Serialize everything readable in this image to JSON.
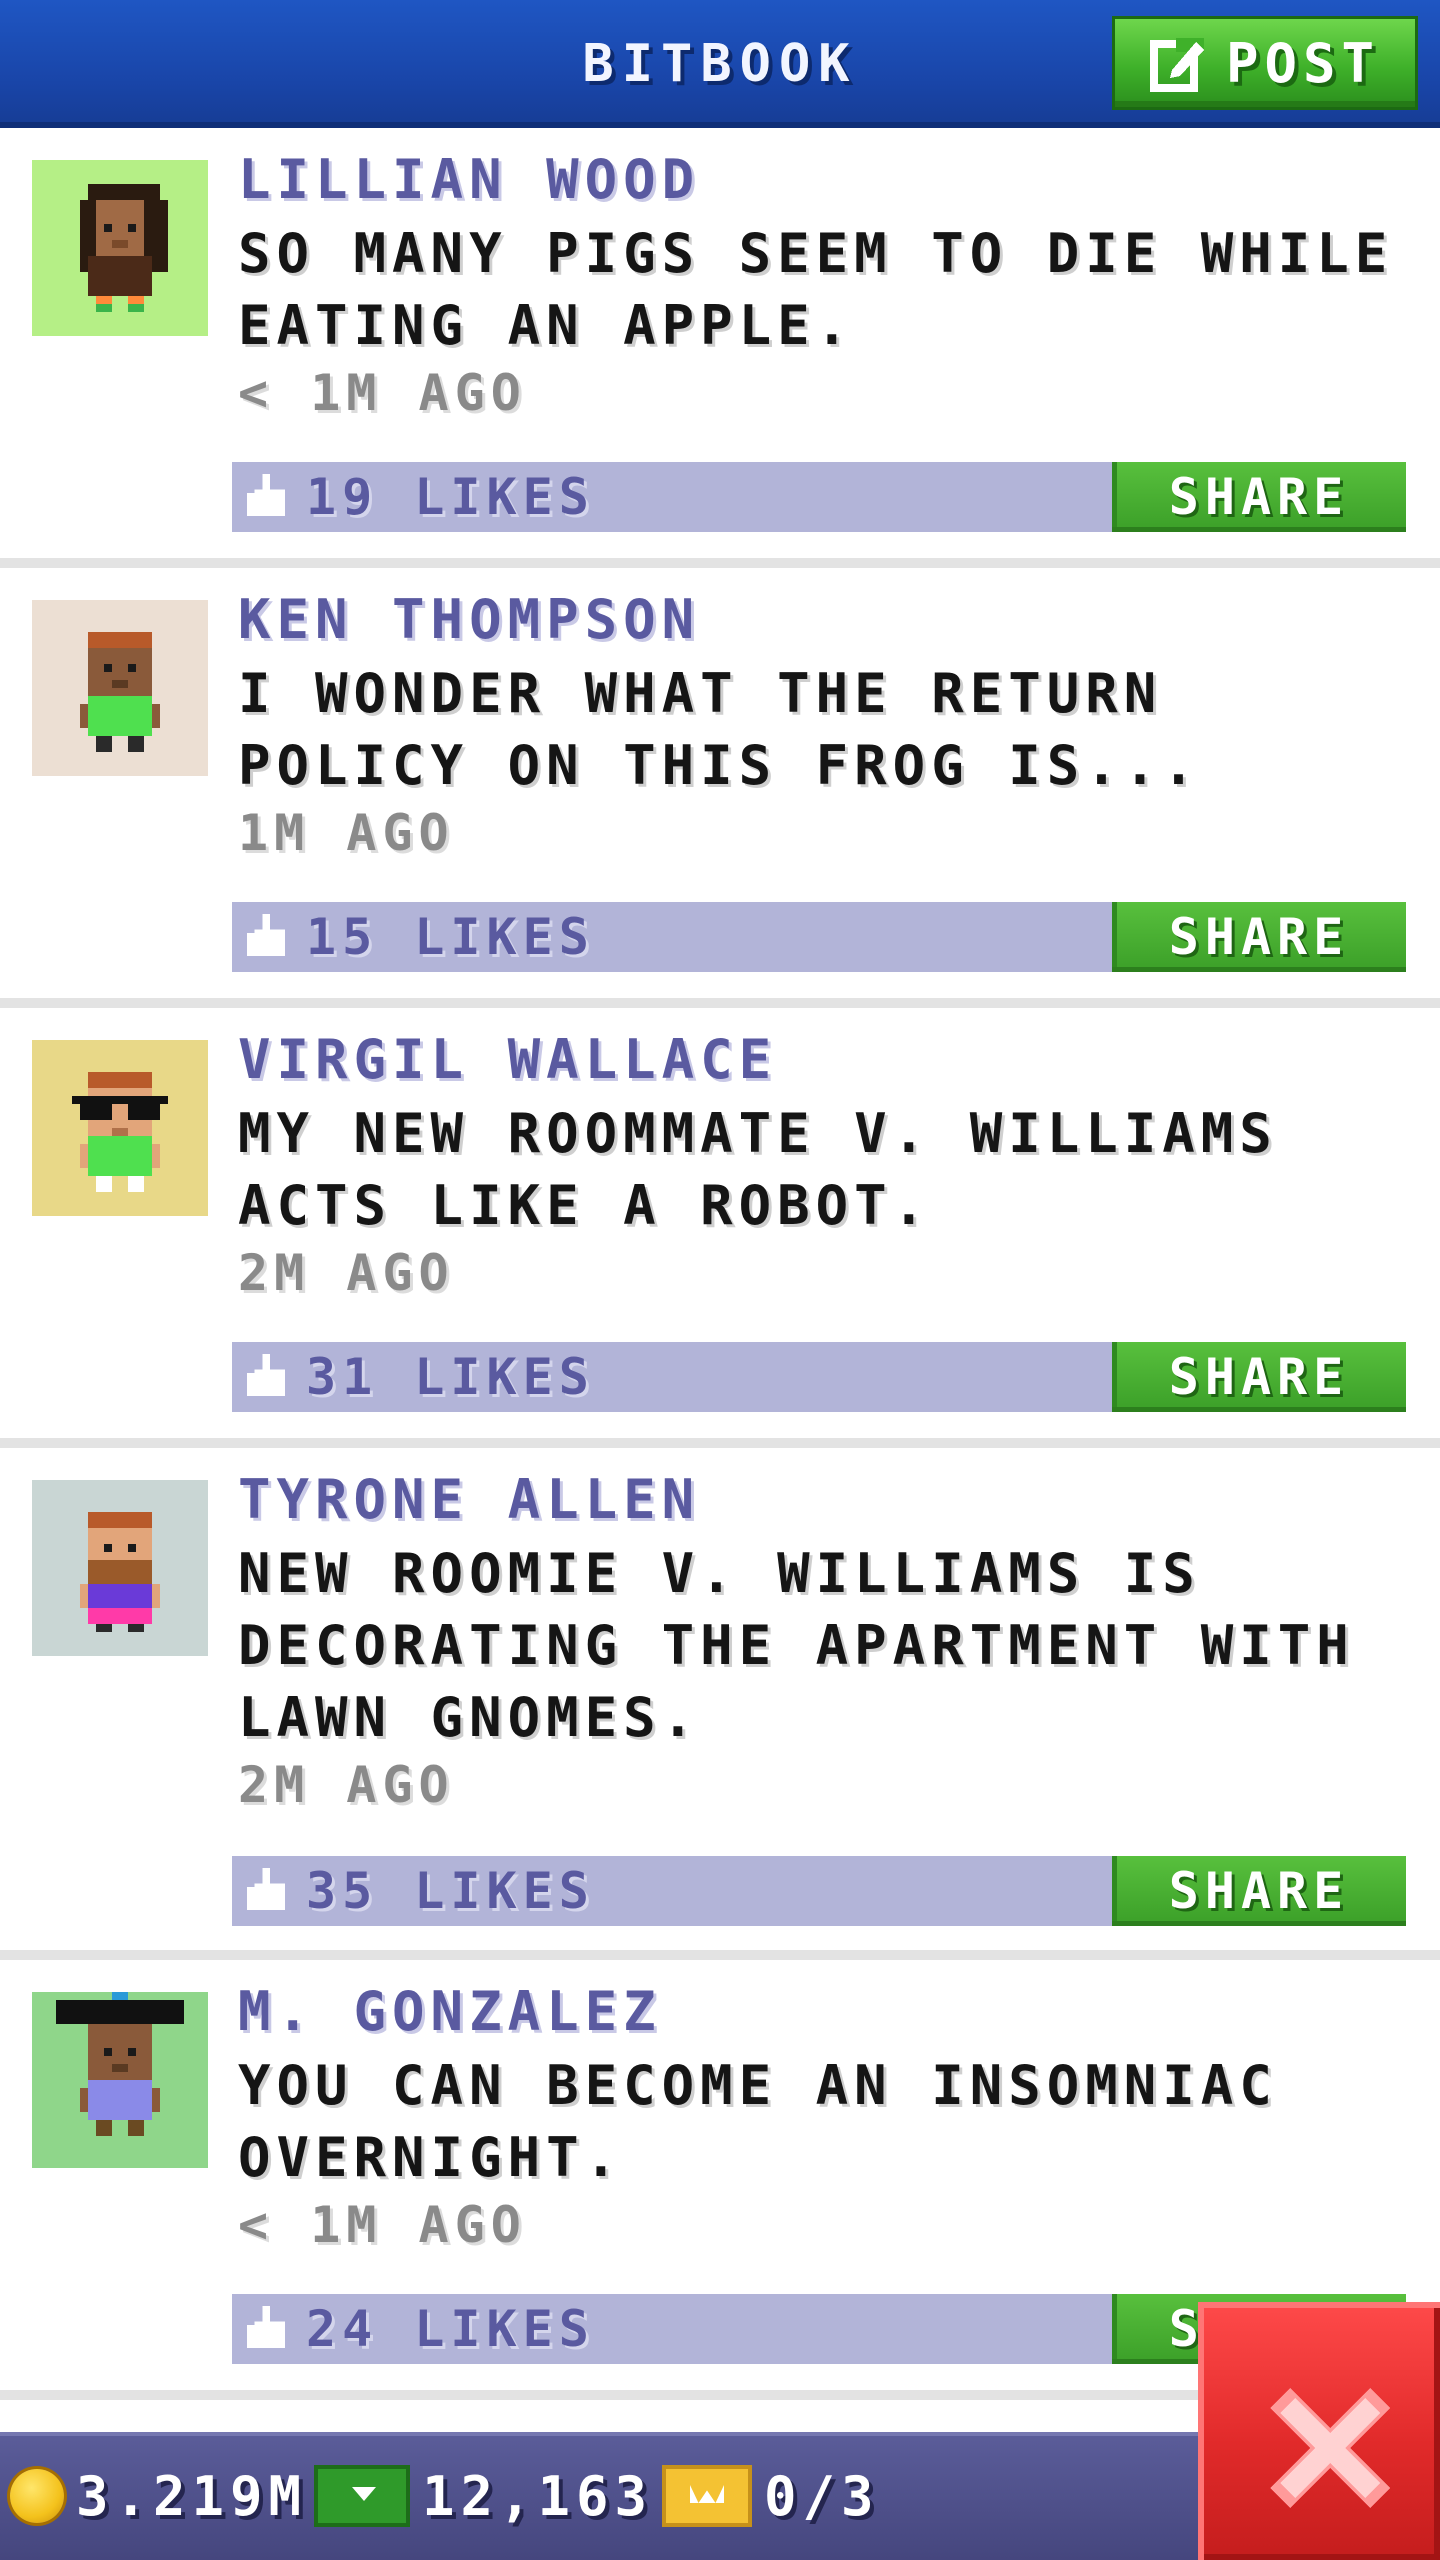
{
  "header": {
    "title": "BITBOOK",
    "post_label": "POST"
  },
  "posts": [
    {
      "name": "LILLIAN WOOD",
      "text": "SO MANY PIGS SEEM TO DIE WHILE EATING AN APPLE.",
      "time": "< 1M AGO",
      "likes": "19 LIKES",
      "share": "SHARE",
      "avatar_bg": "#b5ef86",
      "avatar_icon": "lillian-wood-avatar-icon"
    },
    {
      "name": "KEN THOMPSON",
      "text": "I WONDER WHAT THE RETURN POLICY ON THIS FROG IS...",
      "time": "1M AGO",
      "likes": "15 LIKES",
      "share": "SHARE",
      "avatar_bg": "#ecdfd3",
      "avatar_icon": "ken-thompson-avatar-icon"
    },
    {
      "name": "VIRGIL WALLACE",
      "text": "MY NEW ROOMMATE V. WILLIAMS ACTS LIKE A ROBOT.",
      "time": "2M AGO",
      "likes": "31 LIKES",
      "share": "SHARE",
      "avatar_bg": "#e8d888",
      "avatar_icon": "virgil-wallace-avatar-icon"
    },
    {
      "name": "TYRONE ALLEN",
      "text": "NEW ROOMIE V. WILLIAMS IS DECORATING THE APARTMENT WITH LAWN GNOMES.",
      "time": "2M AGO",
      "likes": "35 LIKES",
      "share": "SHARE",
      "avatar_bg": "#c9d6d4",
      "avatar_icon": "tyrone-allen-avatar-icon"
    },
    {
      "name": "M. GONZALEZ",
      "text": "YOU CAN BECOME AN INSOMNIAC OVERNIGHT.",
      "time": "< 1M AGO",
      "likes": "24 LIKES",
      "share": "SHARE",
      "avatar_bg": "#8fd68a",
      "avatar_icon": "m-gonzalez-avatar-icon"
    }
  ],
  "status": {
    "coins": "3.219M",
    "bux": "12,163",
    "tickets": "0/3"
  },
  "colors": {
    "header_blue": "#1945a8",
    "accent_green": "#3fb12a",
    "likes_bar": "#b2b4d8",
    "name_purple": "#5a5aa0",
    "close_red": "#e12a2a"
  }
}
